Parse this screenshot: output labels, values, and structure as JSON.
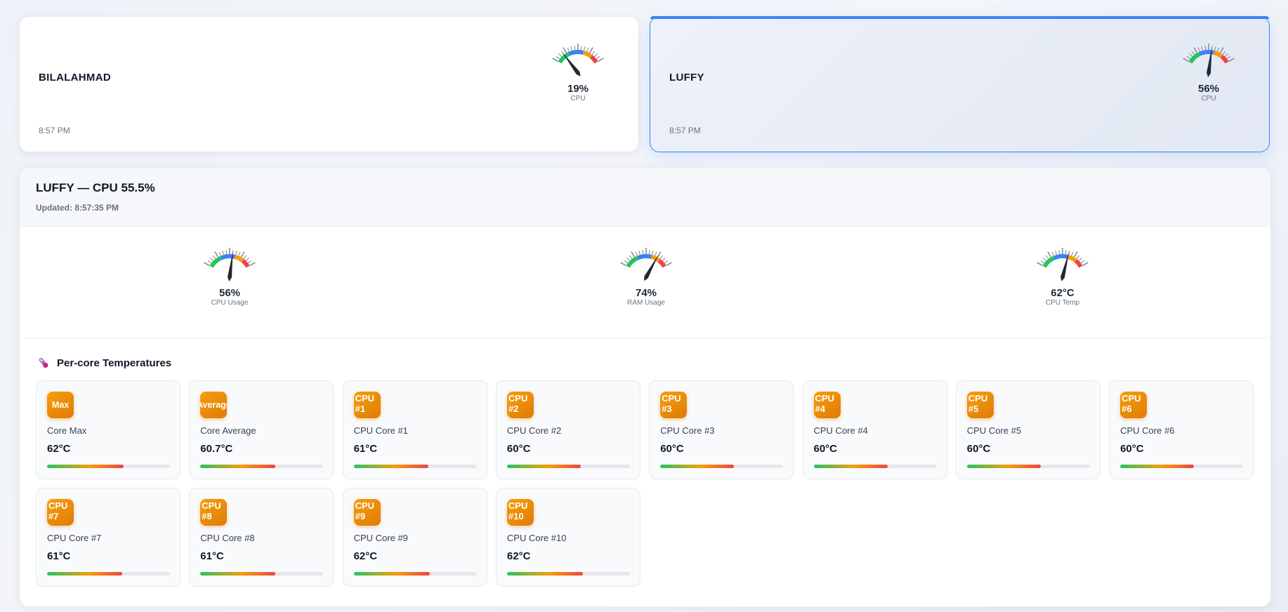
{
  "hosts": [
    {
      "name": "BILALAHMAD",
      "time": "8:57 PM",
      "gauge": {
        "value": 19,
        "value_text": "19%",
        "label": "CPU"
      }
    },
    {
      "name": "LUFFY",
      "time": "8:57 PM",
      "gauge": {
        "value": 56,
        "value_text": "56%",
        "label": "CPU"
      }
    }
  ],
  "detail": {
    "title": "LUFFY — CPU 55.5%",
    "updated": "Updated: 8:57:35 PM",
    "gauges": [
      {
        "value": 56,
        "value_text": "56%",
        "label": "CPU Usage"
      },
      {
        "value": 74,
        "value_text": "74%",
        "label": "RAM Usage"
      },
      {
        "value": 62,
        "value_text": "62°C",
        "label": "CPU Temp"
      }
    ],
    "section_title": "Per-core Temperatures",
    "section_icon": "thermometer-icon",
    "cores": [
      {
        "badge": "Max",
        "label": "Core Max",
        "value": "62°C",
        "fill": 62
      },
      {
        "badge": "Average",
        "label": "Core Average",
        "value": "60.7°C",
        "fill": 60.7
      },
      {
        "badge": "CPU #1",
        "label": "CPU Core #1",
        "value": "61°C",
        "fill": 61
      },
      {
        "badge": "CPU #2",
        "label": "CPU Core #2",
        "value": "60°C",
        "fill": 60
      },
      {
        "badge": "CPU #3",
        "label": "CPU Core #3",
        "value": "60°C",
        "fill": 60
      },
      {
        "badge": "CPU #4",
        "label": "CPU Core #4",
        "value": "60°C",
        "fill": 60
      },
      {
        "badge": "CPU #5",
        "label": "CPU Core #5",
        "value": "60°C",
        "fill": 60
      },
      {
        "badge": "CPU #6",
        "label": "CPU Core #6",
        "value": "60°C",
        "fill": 60
      },
      {
        "badge": "CPU #7",
        "label": "CPU Core #7",
        "value": "61°C",
        "fill": 61
      },
      {
        "badge": "CPU #8",
        "label": "CPU Core #8",
        "value": "61°C",
        "fill": 61
      },
      {
        "badge": "CPU #9",
        "label": "CPU Core #9",
        "value": "62°C",
        "fill": 62
      },
      {
        "badge": "CPU #10",
        "label": "CPU Core #10",
        "value": "62°C",
        "fill": 62
      }
    ]
  },
  "colors": {
    "accent": "#3b82f6",
    "badge": "#f59e0b",
    "gauge_green": "#22c55e",
    "gauge_blue": "#3b82f6",
    "gauge_orange": "#f59e0b",
    "gauge_red": "#ef4444"
  }
}
